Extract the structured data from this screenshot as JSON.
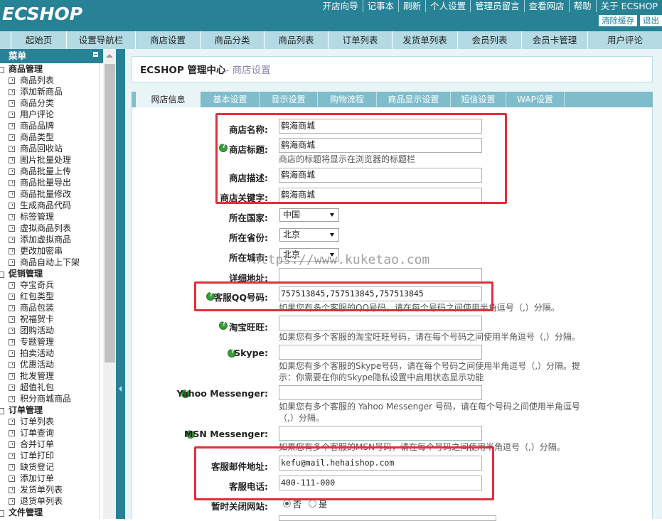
{
  "brand": {
    "logo": "ECSHOP"
  },
  "top_links": [
    "开店向导",
    "记事本",
    "刷新",
    "个人设置",
    "管理员留言",
    "查看网店",
    "帮助",
    "关于 ECSHOP"
  ],
  "top_buttons": {
    "clear_cache": "清除缓存",
    "logout": "退出"
  },
  "nav": [
    "起始页",
    "设置导航栏",
    "商店设置",
    "商品分类",
    "商品列表",
    "订单列表",
    "发货单列表",
    "会员列表",
    "会员卡管理",
    "用户评论"
  ],
  "left": {
    "title": "菜单"
  },
  "menu": [
    {
      "name": "商品管理",
      "items": [
        "商品列表",
        "添加新商品",
        "商品分类",
        "用户评论",
        "商品品牌",
        "商品类型",
        "商品回收站",
        "图片批量处理",
        "商品批量上传",
        "商品批量导出",
        "商品批量修改",
        "生成商品代码",
        "标签管理",
        "虚拟商品列表",
        "添加虚拟商品",
        "更改加密串",
        "商品自动上下架"
      ]
    },
    {
      "name": "促销管理",
      "items": [
        "夺宝奇兵",
        "红包类型",
        "商品包装",
        "祝福贺卡",
        "团购活动",
        "专题管理",
        "拍卖活动",
        "优惠活动",
        "批发管理",
        "超值礼包",
        "积分商城商品"
      ]
    },
    {
      "name": "订单管理",
      "items": [
        "订单列表",
        "订单查询",
        "合并订单",
        "订单打印",
        "缺货登记",
        "添加订单",
        "发货单列表",
        "退货单列表"
      ]
    },
    {
      "name": "文件管理",
      "items": []
    }
  ],
  "breadcrumb": {
    "main": "ECSHOP 管理中心",
    "sub": "- 商店设置"
  },
  "tabs": [
    "网店信息",
    "基本设置",
    "显示设置",
    "购物流程",
    "商品显示设置",
    "短信设置",
    "WAP设置"
  ],
  "form": {
    "shop_name": {
      "label": "商店名称:",
      "value": "鹤海商城"
    },
    "shop_title": {
      "label": "商店标题:",
      "value": "鹤海商城",
      "note": "商店的标题将显示在浏览器的标题栏"
    },
    "shop_desc": {
      "label": "商店描述:",
      "value": "鹤海商城"
    },
    "shop_keywords": {
      "label": "商店关键字:",
      "value": "鹤海商城"
    },
    "country": {
      "label": "所在国家:",
      "value": "中国"
    },
    "province": {
      "label": "所在省份:",
      "value": "北京"
    },
    "city": {
      "label": "所在城市:",
      "value": "北京"
    },
    "address": {
      "label": "详细地址:",
      "value": ""
    },
    "qq": {
      "label": "客服QQ号码:",
      "value": "757513845,757513845,757513845",
      "note": "如果您有多个客服的QQ号码，请在每个号码之间使用半角逗号（,）分隔。"
    },
    "ww": {
      "label": "淘宝旺旺:",
      "value": "",
      "note": "如果您有多个客服的淘宝旺旺号码，请在每个号码之间使用半角逗号（,）分隔。"
    },
    "skype": {
      "label": "Skype:",
      "value": "",
      "note1": "如果您有多个客服的Skype号码，请在每个号码之间使用半角逗号（,）分隔。提",
      "note2": "示：你需要在你的Skype隐私设置中启用状态显示功能"
    },
    "yahoo": {
      "label": "Yahoo Messenger:",
      "value": "",
      "note1": "如果您有多个客服的 Yahoo Messenger 号码，请在每个号码之间使用半角逗号",
      "note2": "（,）分隔。"
    },
    "msn": {
      "label": "MSN Messenger:",
      "value": "",
      "note": "如果您有多个客服的MSN号码，请在每个号码之间使用半角逗号（,）分隔。"
    },
    "email": {
      "label": "客服邮件地址:",
      "value": "kefu@mail.hehaishop.com"
    },
    "phone": {
      "label": "客服电话:",
      "value": "400-111-000"
    },
    "closed": {
      "label": "暂时关闭网站:",
      "no": "否",
      "yes": "是"
    }
  },
  "watermark": "https://www.kuketao.com",
  "colors": {
    "header": "#278296",
    "nav": "#80bdcb",
    "highlight": "#e0303a",
    "help": "#3b9a3b"
  }
}
